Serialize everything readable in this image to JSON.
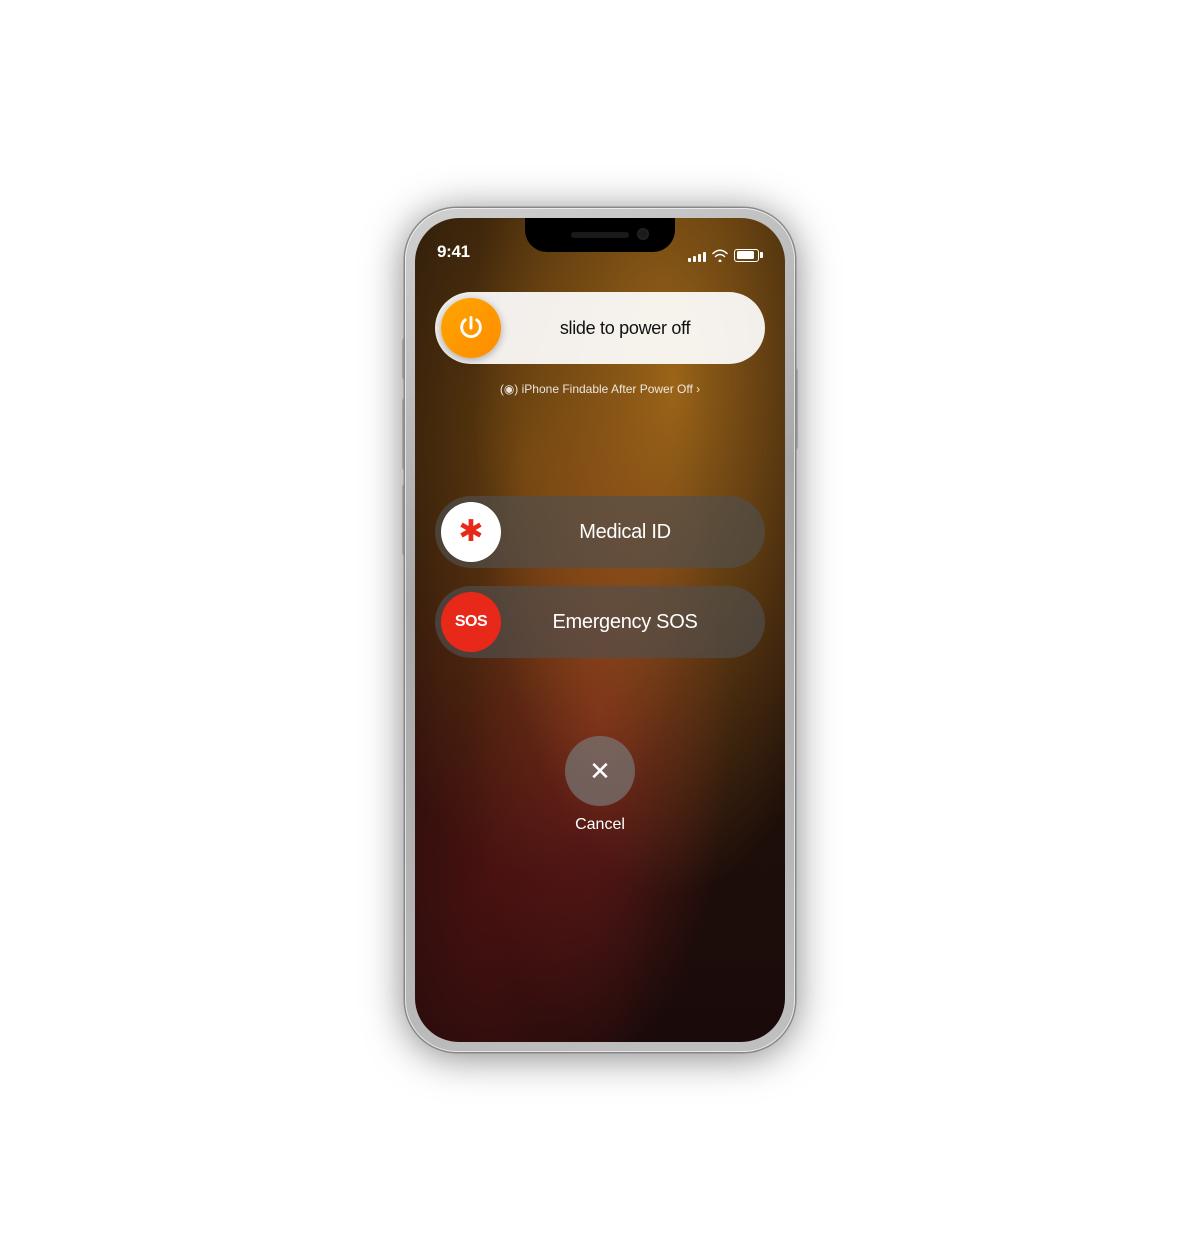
{
  "phone": {
    "status_bar": {
      "time": "9:41",
      "signal_bars": [
        4,
        6,
        8,
        10,
        12
      ],
      "battery_level": 85
    },
    "power_slider": {
      "label": "slide to power off"
    },
    "findable": {
      "text": "(◉) iPhone Findable After Power Off ›"
    },
    "medical_slider": {
      "icon_text": "✱",
      "label": "Medical ID"
    },
    "sos_slider": {
      "icon_text": "SOS",
      "label": "Emergency SOS"
    },
    "cancel_button": {
      "label": "Cancel"
    }
  }
}
